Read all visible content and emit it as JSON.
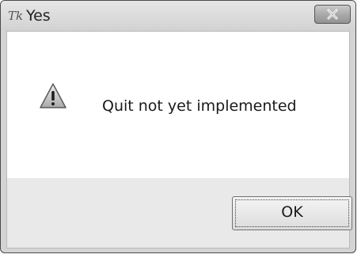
{
  "window": {
    "title": "Yes",
    "app_icon": "tk-feather-icon"
  },
  "dialog": {
    "icon": "warning-icon",
    "message": "Quit not yet implemented",
    "ok_label": "OK"
  }
}
